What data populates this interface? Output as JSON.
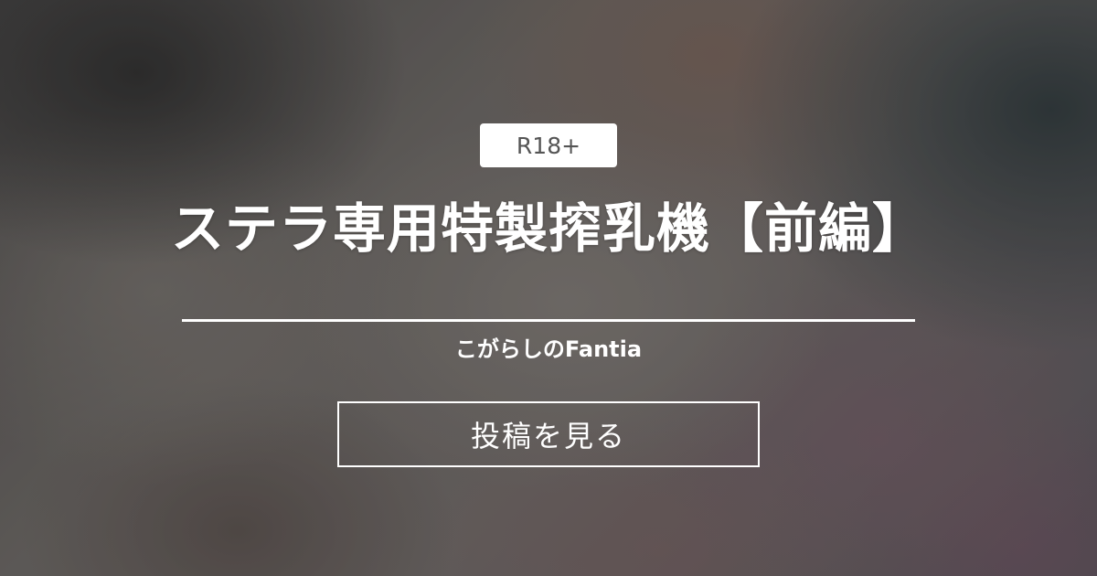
{
  "badge": {
    "label": "R18+"
  },
  "post": {
    "title": "ステラ専用特製搾乳機【前編】",
    "creator": "こがらしのFantia"
  },
  "cta": {
    "label": "投稿を見る"
  },
  "colors": {
    "text": "#ffffff",
    "badge_background": "#ffffff",
    "badge_text": "#555555"
  }
}
